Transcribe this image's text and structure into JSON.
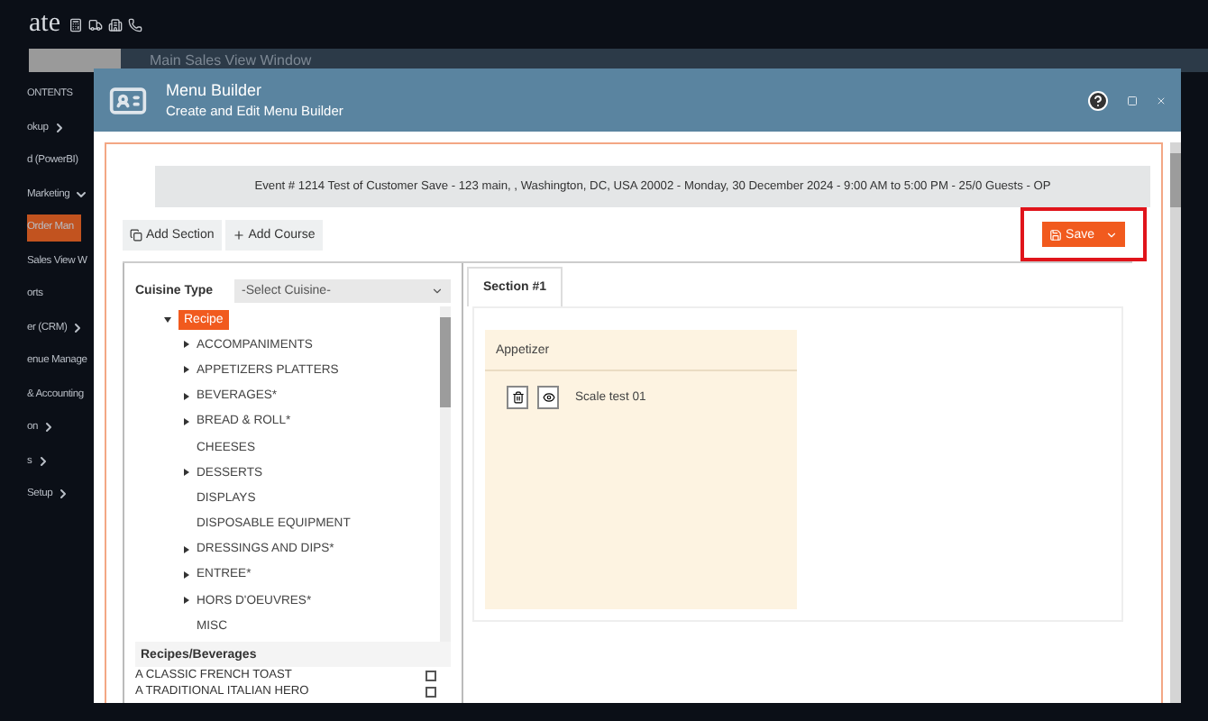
{
  "app": {
    "logo_text": "ate",
    "tabs": [
      {
        "label": "Main Sales View Window",
        "selected": false
      }
    ]
  },
  "sidebar": {
    "items": [
      {
        "label": "ONTENTS",
        "kind": "heading",
        "expandable": false,
        "selected": false
      },
      {
        "label": "okup",
        "kind": "item",
        "expandable": true,
        "expanded": false,
        "selected": false
      },
      {
        "label": "d (PowerBI)",
        "kind": "item",
        "expandable": false,
        "selected": false
      },
      {
        "label": "Marketing",
        "kind": "item",
        "expandable": true,
        "expanded": true,
        "selected": false
      },
      {
        "label": "Order Man",
        "kind": "item",
        "expandable": false,
        "selected": true
      },
      {
        "label": "Sales View W",
        "kind": "item",
        "expandable": false,
        "selected": false
      },
      {
        "label": "orts",
        "kind": "item",
        "expandable": false,
        "selected": false
      },
      {
        "label": "er (CRM)",
        "kind": "item",
        "expandable": true,
        "expanded": false,
        "selected": false
      },
      {
        "label": "enue Manage",
        "kind": "item",
        "expandable": false,
        "selected": false
      },
      {
        "label": "& Accounting",
        "kind": "item",
        "expandable": false,
        "selected": false
      },
      {
        "label": "on",
        "kind": "item",
        "expandable": true,
        "expanded": false,
        "selected": false
      },
      {
        "label": "s",
        "kind": "item",
        "expandable": true,
        "expanded": false,
        "selected": false
      },
      {
        "label": "Setup",
        "kind": "item",
        "expandable": true,
        "expanded": false,
        "selected": false
      }
    ]
  },
  "modal": {
    "title": "Menu Builder",
    "subtitle": "Create and Edit Menu Builder",
    "event_banner": "Event # 1214 Test of Customer Save - 123 main, , Washington, DC, USA 20002 - Monday, 30 December 2024 - 9:00 AM to 5:00 PM - 25/0 Guests - OP",
    "toolbar": [
      {
        "label": "Add Section",
        "kind": "section"
      },
      {
        "label": "Add Course",
        "kind": "course"
      }
    ],
    "save_button": {
      "label": "Save",
      "highlighted": true
    },
    "cuisine": {
      "label": "Cuisine Type",
      "value": "-Select Cuisine-"
    },
    "tree": [
      {
        "label": "Recipe",
        "selected": true,
        "expanded": true,
        "children": [
          {
            "label": "ACCOMPANIMENTS",
            "expandable": true
          },
          {
            "label": "APPETIZERS PLATTERS",
            "expandable": true
          },
          {
            "label": "BEVERAGES*",
            "expandable": true
          },
          {
            "label": "BREAD & ROLL*",
            "expandable": true
          },
          {
            "label": "CHEESES",
            "expandable": false
          },
          {
            "label": "DESSERTS",
            "expandable": true
          },
          {
            "label": "DISPLAYS",
            "expandable": false
          },
          {
            "label": "DISPOSABLE EQUIPMENT",
            "expandable": false
          },
          {
            "label": "DRESSINGS AND DIPS*",
            "expandable": true
          },
          {
            "label": "ENTREE*",
            "expandable": true
          },
          {
            "label": "HORS D'OEUVRES*",
            "expandable": true
          },
          {
            "label": "MISC",
            "expandable": false
          }
        ]
      }
    ],
    "recipes": {
      "heading": "Recipes/Beverages",
      "items": [
        {
          "label": "A CLASSIC FRENCH TOAST",
          "checked": false
        },
        {
          "label": "A TRADITIONAL ITALIAN HERO",
          "checked": false
        }
      ]
    },
    "section_tabs": [
      {
        "label": "Section #1",
        "selected": true
      }
    ],
    "courses": [
      {
        "title": "Appetizer",
        "items": [
          {
            "label": "Scale test 01"
          }
        ]
      }
    ]
  }
}
